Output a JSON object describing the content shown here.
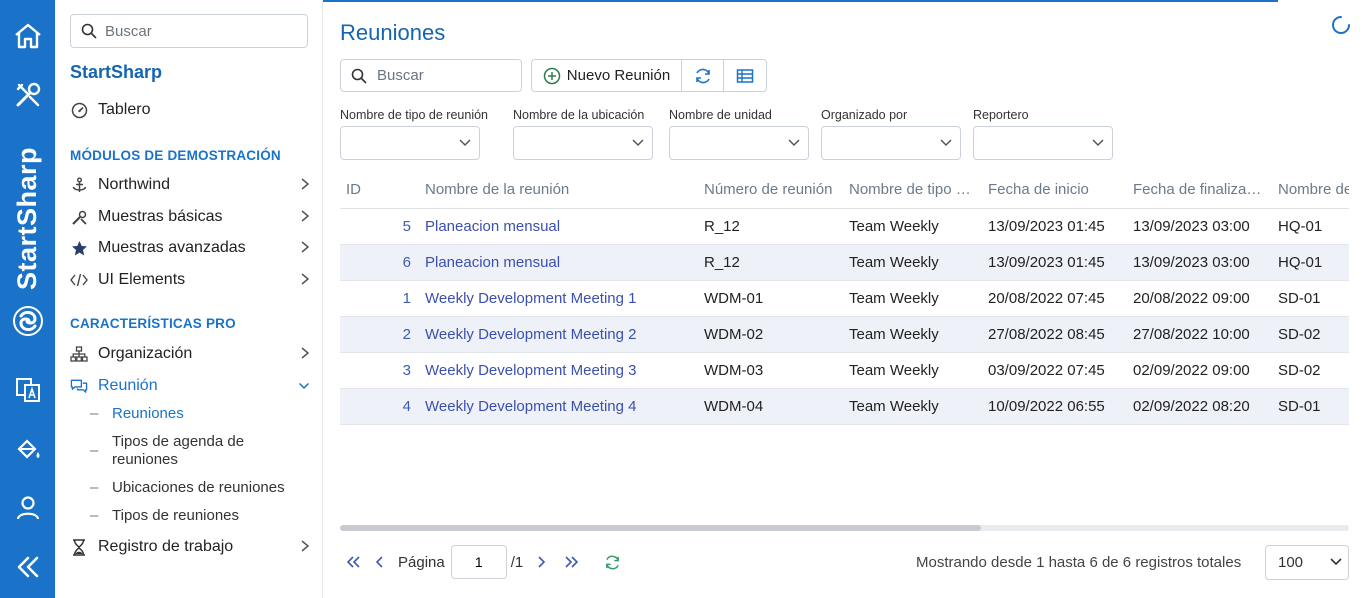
{
  "rail": {
    "brand": "StartSharp"
  },
  "sidebar": {
    "search_placeholder": "Buscar",
    "app_title": "StartSharp",
    "dashboard": "Tablero",
    "sections": {
      "demo": "MÓDULOS DE DEMOSTRACIÓN",
      "pro": "CARACTERÍSTICAS PRO"
    },
    "items": [
      {
        "label": "Northwind",
        "icon": "anchor-icon"
      },
      {
        "label": "Muestras básicas",
        "icon": "tools-icon"
      },
      {
        "label": "Muestras avanzadas",
        "icon": "star-icon"
      },
      {
        "label": "UI Elements",
        "icon": "code-icon"
      },
      {
        "label": "Organización",
        "icon": "sitemap-icon"
      },
      {
        "label": "Reunión",
        "icon": "comments-icon"
      },
      {
        "label": "Registro de trabajo",
        "icon": "hourglass-icon"
      }
    ],
    "subitems": [
      {
        "label": "Reuniones"
      },
      {
        "label": "Tipos de agenda de reuniones"
      },
      {
        "label": "Ubicaciones de reuniones"
      },
      {
        "label": "Tipos de reuniones"
      }
    ]
  },
  "main": {
    "title": "Reuniones",
    "search_placeholder": "Buscar",
    "new_button": "Nuevo Reunión",
    "filters": [
      {
        "label": "Nombre de tipo de reunión"
      },
      {
        "label": "Nombre de la ubicación"
      },
      {
        "label": "Nombre de unidad"
      },
      {
        "label": "Organizado por"
      },
      {
        "label": "Reportero"
      }
    ],
    "columns": [
      "ID",
      "Nombre de la reunión",
      "Número de reunión",
      "Nombre de tipo de reunión",
      "Fecha de inicio",
      "Fecha de finalización",
      "Nombre de la ubicación"
    ],
    "rows": [
      {
        "id": "5",
        "name": "Planeacion mensual",
        "number": "R_12",
        "type": "Team Weekly",
        "start": "13/09/2023 01:45",
        "end": "13/09/2023 03:00",
        "location": "HQ-01"
      },
      {
        "id": "6",
        "name": "Planeacion mensual",
        "number": "R_12",
        "type": "Team Weekly",
        "start": "13/09/2023 01:45",
        "end": "13/09/2023 03:00",
        "location": "HQ-01"
      },
      {
        "id": "1",
        "name": "Weekly Development Meeting 1",
        "number": "WDM-01",
        "type": "Team Weekly",
        "start": "20/08/2022 07:45",
        "end": "20/08/2022 09:00",
        "location": "SD-01"
      },
      {
        "id": "2",
        "name": "Weekly Development Meeting 2",
        "number": "WDM-02",
        "type": "Team Weekly",
        "start": "27/08/2022 08:45",
        "end": "27/08/2022 10:00",
        "location": "SD-02"
      },
      {
        "id": "3",
        "name": "Weekly Development Meeting 3",
        "number": "WDM-03",
        "type": "Team Weekly",
        "start": "03/09/2022 07:45",
        "end": "02/09/2022 09:00",
        "location": "SD-02"
      },
      {
        "id": "4",
        "name": "Weekly Development Meeting 4",
        "number": "WDM-04",
        "type": "Team Weekly",
        "start": "10/09/2022 06:55",
        "end": "02/09/2022 08:20",
        "location": "SD-01"
      }
    ],
    "pager": {
      "page_label": "Página",
      "page_value": "1",
      "total_pages": "/1",
      "status": "Mostrando desde 1 hasta 6 de 6 registros totales",
      "page_size": "100"
    }
  }
}
